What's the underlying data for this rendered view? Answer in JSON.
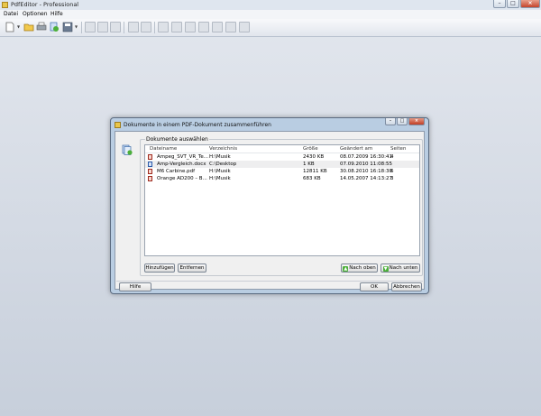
{
  "window": {
    "title": "PdfEditor - Professional",
    "controls": {
      "minimize": "–",
      "maximize": "□",
      "close": "×"
    }
  },
  "menu": [
    "Datei",
    "Optionen",
    "Hilfe"
  ],
  "toolbar": {
    "icons": [
      "new-document-icon",
      "open-folder-icon",
      "print-icon",
      "document-refresh-icon",
      "save-icon",
      "cut-icon",
      "delete-icon",
      "crop-icon",
      "select-arrow-icon",
      "zoom-icon",
      "fit-height-icon",
      "fit-width-icon",
      "page-icon",
      "edit-icon",
      "text-icon",
      "image-icon",
      "tool-icon"
    ]
  },
  "dialog": {
    "title": "Dokumente in einem PDF-Dokument zusammenführen",
    "group_label": "Dokumente auswählen",
    "columns": [
      "Dateiname",
      "Verzeichnis",
      "Größe",
      "Geändert am",
      "Seiten"
    ],
    "rows": [
      {
        "name": "Ampeg_SVT_VR_Te...",
        "dir": "H:\\Musik",
        "size": "2430 KB",
        "modified": "08.07.2009 16:30:41",
        "pages": "4",
        "type": "pdf"
      },
      {
        "name": "Amp-Vergleich.docx",
        "dir": "C:\\Desktop",
        "size": "1 KB",
        "modified": "07.09.2010 11:08:55",
        "pages": "",
        "type": "doc"
      },
      {
        "name": "M6 Carbine.pdf",
        "dir": "H:\\Musik",
        "size": "12811 KB",
        "modified": "30.08.2010 16:18:30",
        "pages": "6",
        "type": "pdf"
      },
      {
        "name": "Orange AD200 – B...",
        "dir": "H:\\Musik",
        "size": "683 KB",
        "modified": "14.05.2007 14:13:27",
        "pages": "3",
        "type": "pdf"
      }
    ],
    "buttons": {
      "add": "Hinzufügen",
      "remove": "Entfernen",
      "move_up": "Nach oben",
      "move_down": "Nach unten",
      "help": "Hilfe",
      "ok": "OK",
      "cancel": "Abbrechen"
    }
  }
}
